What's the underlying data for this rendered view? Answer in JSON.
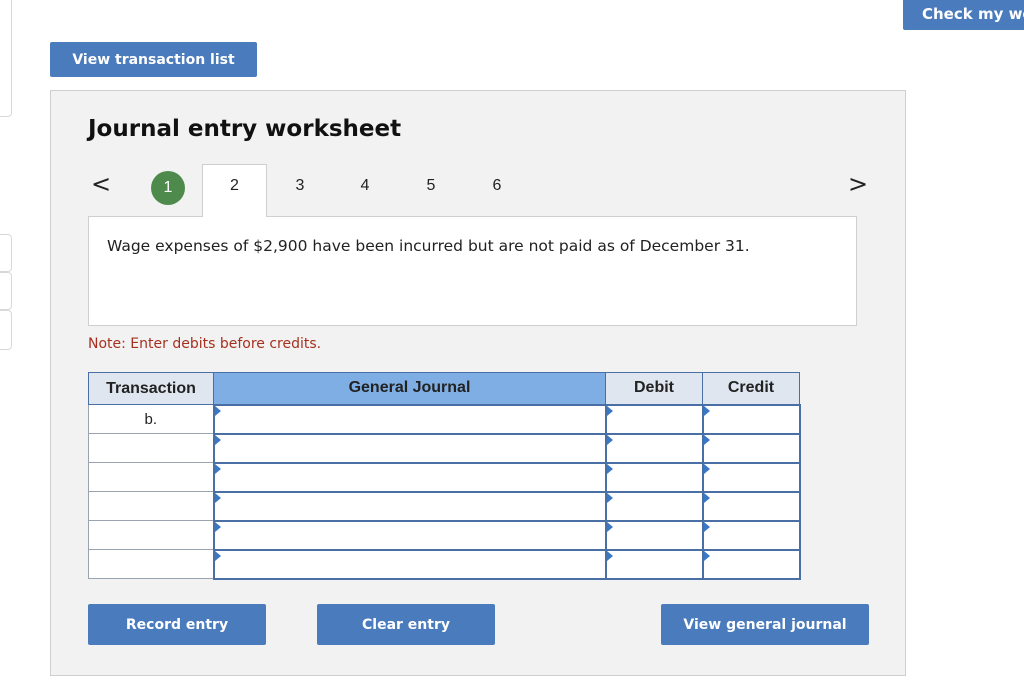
{
  "header": {
    "view_transactions_label": "View transaction list",
    "check_work_label": "Check my wo"
  },
  "worksheet": {
    "title": "Journal entry worksheet",
    "steps": [
      "1",
      "2",
      "3",
      "4",
      "5",
      "6"
    ],
    "current_step": "2",
    "completed_steps": [
      "1"
    ],
    "prev_arrow": "<",
    "next_arrow": ">",
    "description": "Wage expenses of $2,900 have been incurred but are not paid as of December 31.",
    "note": "Note: Enter debits before credits."
  },
  "journal_table": {
    "headers": {
      "transaction": "Transaction",
      "general_journal": "General Journal",
      "debit": "Debit",
      "credit": "Credit"
    },
    "rows": [
      {
        "transaction": "b.",
        "account": "",
        "debit": "",
        "credit": ""
      },
      {
        "transaction": "",
        "account": "",
        "debit": "",
        "credit": ""
      },
      {
        "transaction": "",
        "account": "",
        "debit": "",
        "credit": ""
      },
      {
        "transaction": "",
        "account": "",
        "debit": "",
        "credit": ""
      },
      {
        "transaction": "",
        "account": "",
        "debit": "",
        "credit": ""
      },
      {
        "transaction": "",
        "account": "",
        "debit": "",
        "credit": ""
      }
    ]
  },
  "actions": {
    "record_label": "Record entry",
    "clear_label": "Clear entry",
    "view_journal_label": "View general journal"
  },
  "colors": {
    "button_blue": "#4a7bbd",
    "step_done_green": "#4e8a4b",
    "note_red": "#a6301f",
    "header_blue": "#7eaee3"
  }
}
